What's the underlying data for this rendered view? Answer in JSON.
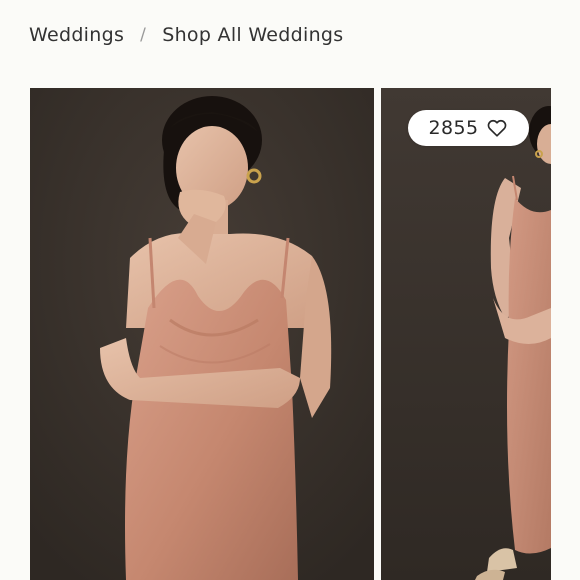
{
  "breadcrumb": {
    "items": [
      {
        "label": "Weddings"
      },
      {
        "label": "Shop All Weddings"
      }
    ],
    "separator": "/"
  },
  "gallery": {
    "images": [
      {
        "icon": "model-portrait-image",
        "description_color": "#c88d79"
      },
      {
        "icon": "model-full-length-image",
        "description_color": "#c88d79"
      }
    ],
    "like_count": "2855",
    "like_icon": "heart-outline-icon"
  },
  "colors": {
    "background": "#fbfbf8",
    "photo_backdrop": "#3b342e",
    "dress": "#c88d79",
    "text": "#333333"
  }
}
